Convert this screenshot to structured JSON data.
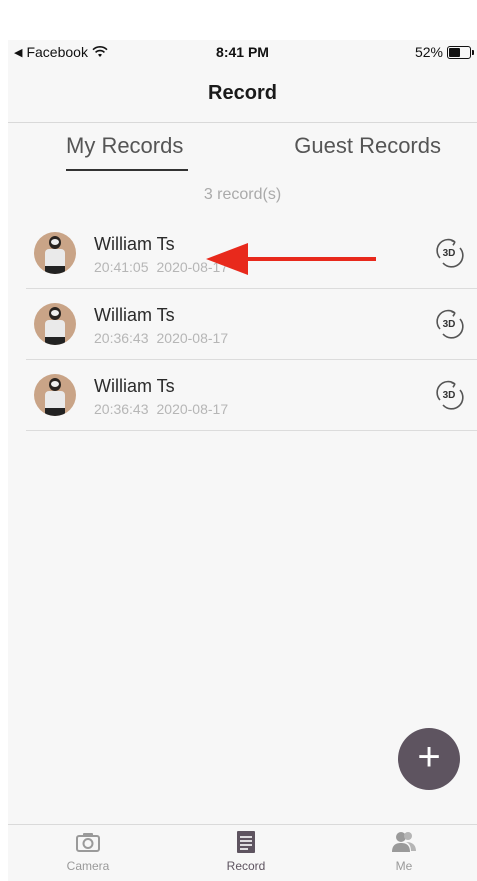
{
  "status_bar": {
    "back_app": "Facebook",
    "time": "8:41 PM",
    "battery": "52%",
    "battery_level": 0.52
  },
  "nav": {
    "title": "Record"
  },
  "tabs": [
    {
      "label": "My Records",
      "active": true
    },
    {
      "label": "Guest Records",
      "active": false
    }
  ],
  "record_count": "3  record(s)",
  "records": [
    {
      "name": "William Ts",
      "time": "20:41:05",
      "date": "2020-08-17",
      "badge": "3D"
    },
    {
      "name": "William Ts",
      "time": "20:36:43",
      "date": "2020-08-17",
      "badge": "3D"
    },
    {
      "name": "William Ts",
      "time": "20:36:43",
      "date": "2020-08-17",
      "badge": "3D"
    }
  ],
  "fab": {
    "label": "+"
  },
  "tabbar": [
    {
      "label": "Camera",
      "icon": "camera-icon"
    },
    {
      "label": "Record",
      "icon": "document-icon"
    },
    {
      "label": "Me",
      "icon": "people-icon"
    }
  ],
  "colors": {
    "accent": "#5e5460",
    "arrow": "#e8291c",
    "muted": "#b6b6b6"
  }
}
